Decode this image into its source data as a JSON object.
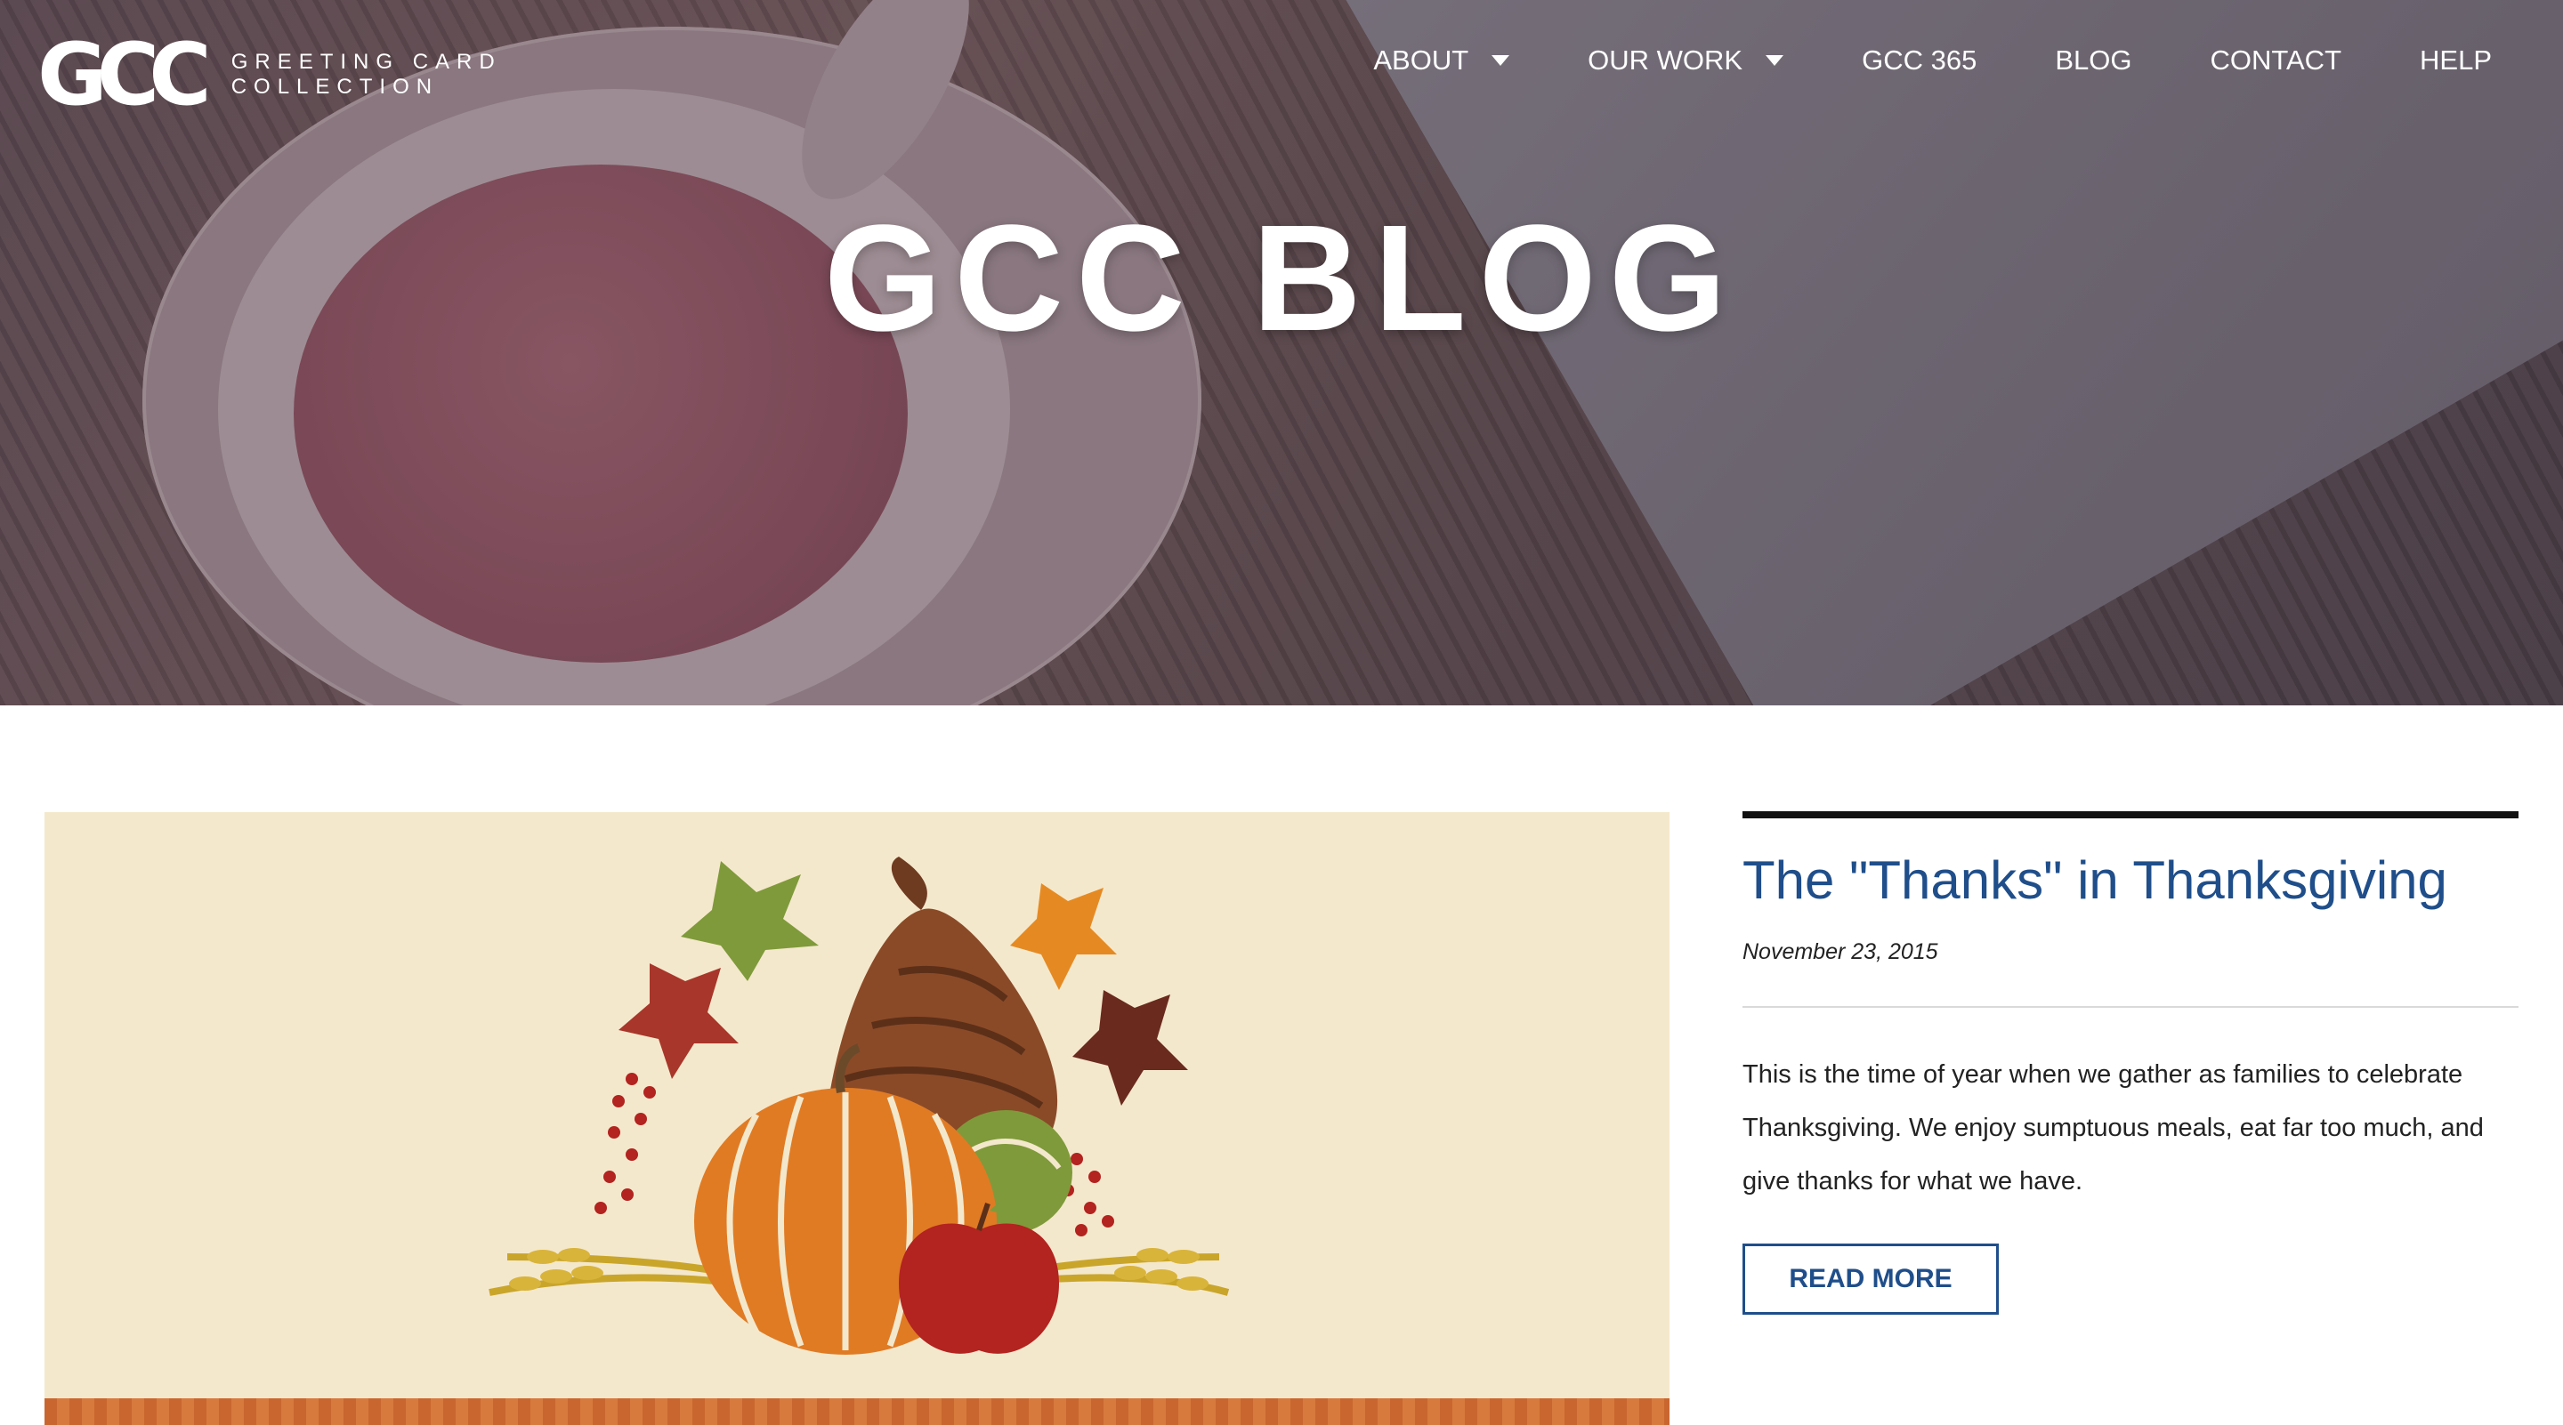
{
  "header": {
    "logo_mark": "GCC",
    "logo_text_line1": "GREETING CARD",
    "logo_text_line2": "COLLECTION"
  },
  "nav": {
    "items": [
      {
        "label": "ABOUT",
        "has_dropdown": true
      },
      {
        "label": "OUR WORK",
        "has_dropdown": true
      },
      {
        "label": "GCC 365",
        "has_dropdown": false
      },
      {
        "label": "BLOG",
        "has_dropdown": false
      },
      {
        "label": "CONTACT",
        "has_dropdown": false
      },
      {
        "label": "HELP",
        "has_dropdown": false
      }
    ]
  },
  "hero": {
    "title": "GCC BLOG"
  },
  "post": {
    "title": "The \"Thanks\" in Thanksgiving",
    "date": "November 23, 2015",
    "excerpt": "This is the time of year when we gather as families to celebrate Thanksgiving. We enjoy sumptuous meals, eat far too much, and give thanks for what we have.",
    "read_more_label": "READ MORE",
    "image_icon": "cornucopia-illustration"
  },
  "colors": {
    "accent": "#1f4e8a",
    "image_background": "#f4e8cc",
    "pumpkin": "#e07b24",
    "apple": "#b3231f"
  }
}
